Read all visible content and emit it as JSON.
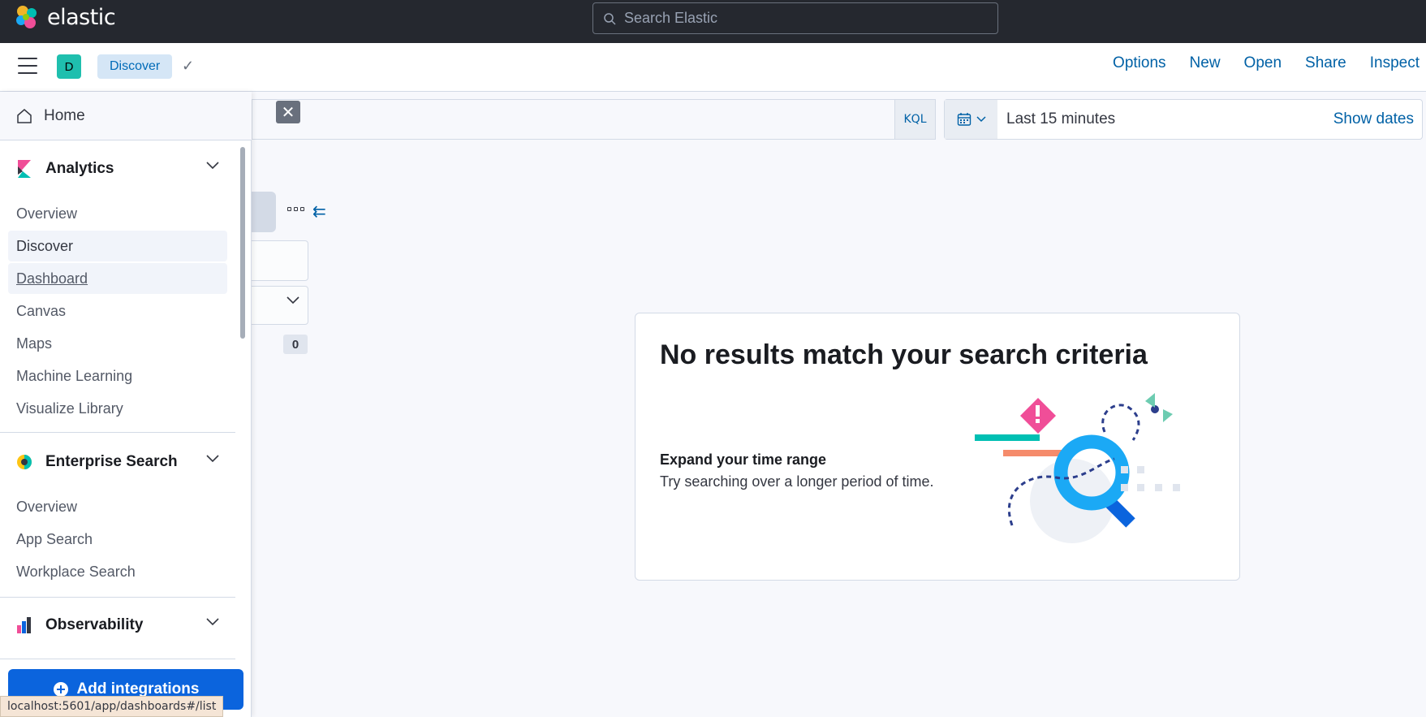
{
  "header": {
    "brand": "elastic",
    "search_placeholder": "Search Elastic"
  },
  "appbar": {
    "space_initial": "D",
    "breadcrumb": "Discover",
    "links": [
      "Options",
      "New",
      "Open",
      "Share",
      "Inspect"
    ]
  },
  "query": {
    "language": "KQL",
    "time_range": "Last 15 minutes",
    "show_dates": "Show dates"
  },
  "fields": {
    "count": "0"
  },
  "nav": {
    "home": "Home",
    "groups": [
      {
        "title": "Analytics",
        "items": [
          "Overview",
          "Discover",
          "Dashboard",
          "Canvas",
          "Maps",
          "Machine Learning",
          "Visualize Library"
        ]
      },
      {
        "title": "Enterprise Search",
        "items": [
          "Overview",
          "App Search",
          "Workplace Search"
        ]
      },
      {
        "title": "Observability",
        "items": []
      }
    ],
    "add_integrations": "Add integrations"
  },
  "empty_state": {
    "title": "No results match your search criteria",
    "subtitle": "Expand your time range",
    "description": "Try searching over a longer period of time."
  },
  "status_bar_url": "localhost:5601/app/dashboards#/list",
  "colors": {
    "header_bg": "#25282f",
    "link": "#0061a6",
    "primary_button": "#0b64dd"
  }
}
